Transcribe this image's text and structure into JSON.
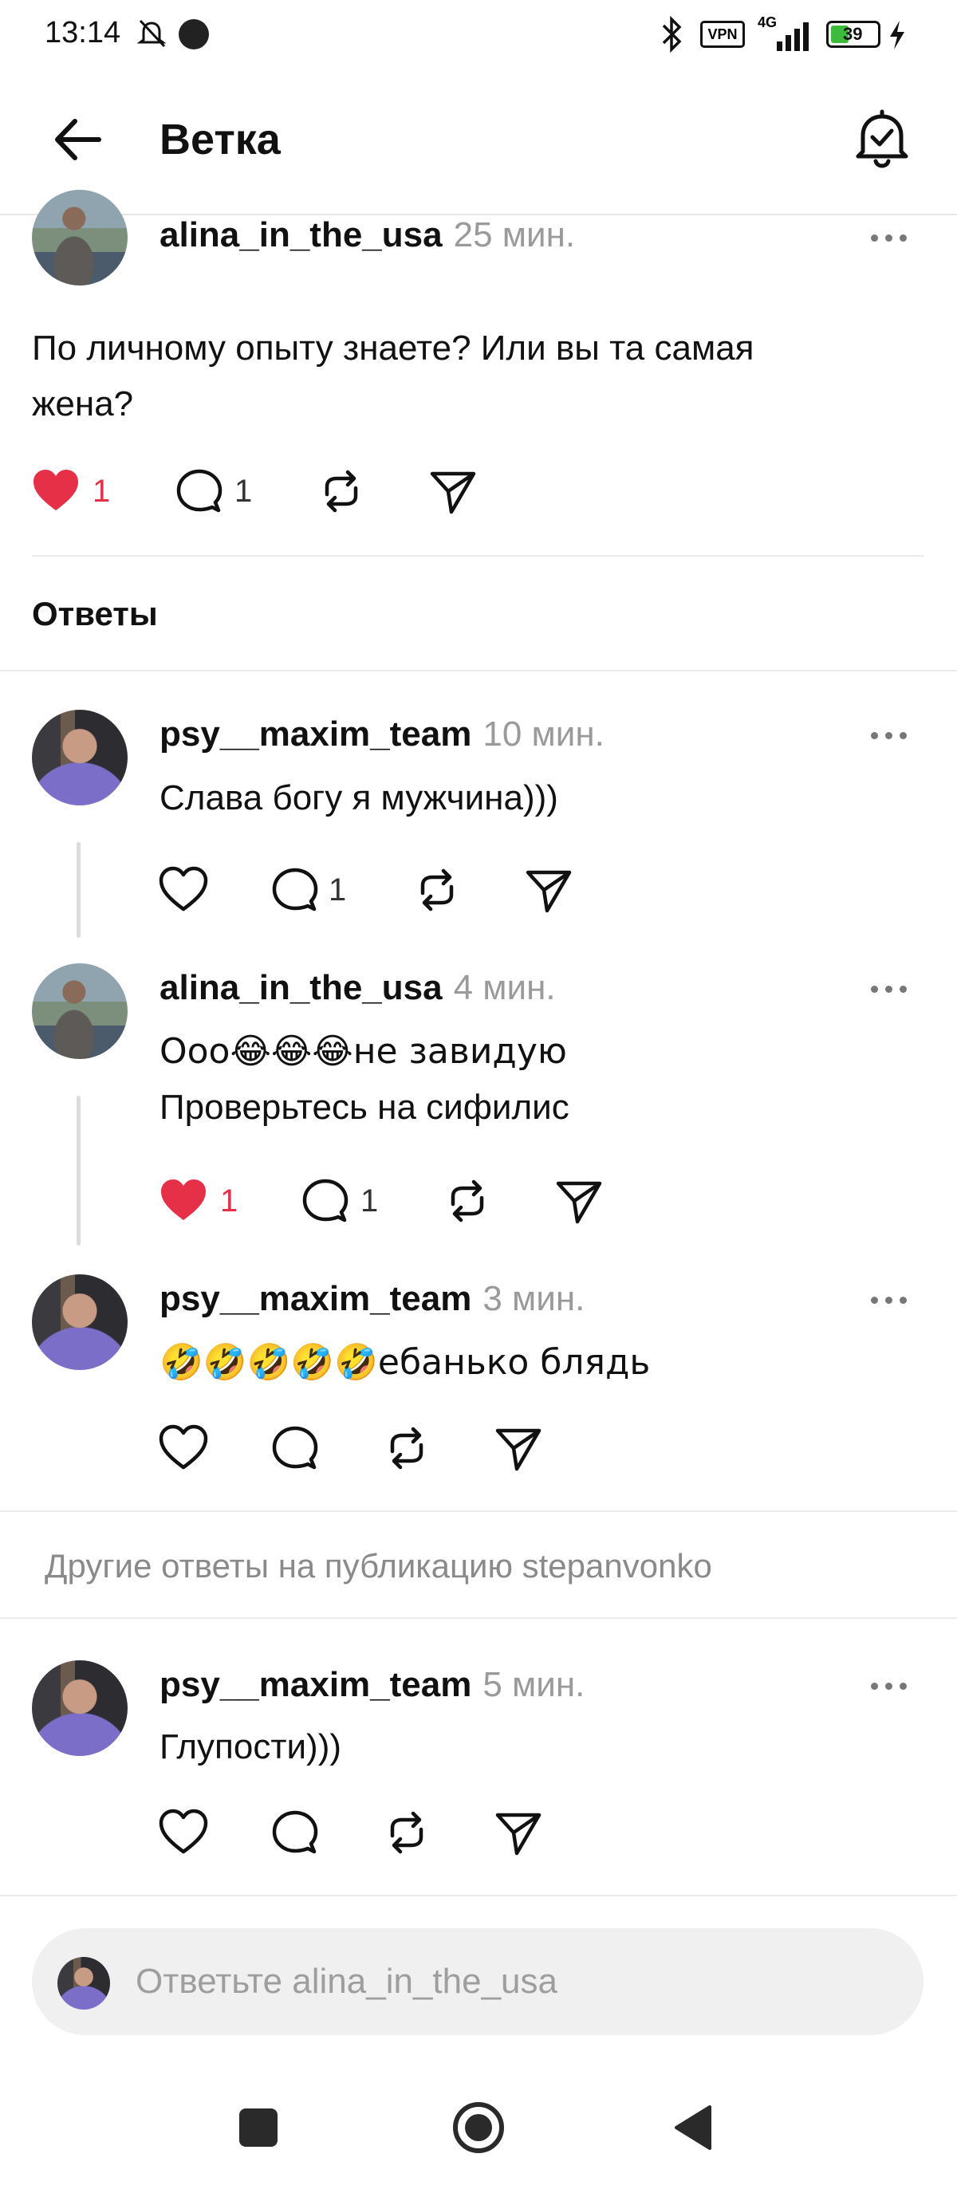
{
  "status_bar": {
    "time": "13:14",
    "battery": "39",
    "network": "4G",
    "vpn": "VPN"
  },
  "header": {
    "title": "Ветка"
  },
  "main_post": {
    "username": "alina_in_the_usa",
    "time": "25 мин.",
    "text_line1": "По личному опыту знаете? Или вы та самая",
    "text_line2": "жена?",
    "likes": "1",
    "comments": "1",
    "liked": true
  },
  "replies_label": "Ответы",
  "replies": [
    {
      "username": "psy__maxim_team",
      "time": "10 мин.",
      "line1": "Слава богу я мужчина)))",
      "line2": "",
      "likes": "",
      "comments": "1"
    },
    {
      "username": "alina_in_the_usa",
      "time": "4 мин.",
      "line1": "Ооо😂😂😂не завидую",
      "line2": "Проверьтесь на сифилис",
      "likes": "1",
      "comments": "1"
    },
    {
      "username": "psy__maxim_team",
      "time": "3 мин.",
      "line1": "🤣🤣🤣🤣🤣ебанько блядь",
      "line2": "",
      "likes": "",
      "comments": ""
    }
  ],
  "other_replies_label": "Другие ответы на публикацию stepanvonko",
  "other_reply": {
    "username": "psy__maxim_team",
    "time": "5 мин.",
    "text": "Глупости)))"
  },
  "reply_input": {
    "placeholder": "Ответьте alina_in_the_usa"
  },
  "colors": {
    "like_red": "#e53048",
    "muted": "#9a9a9a"
  },
  "icons": [
    "back-arrow-icon",
    "bell-check-icon",
    "heart-icon",
    "comment-icon",
    "repost-icon",
    "share-icon",
    "more-icon",
    "nav-square-icon",
    "nav-home-icon",
    "nav-back-icon"
  ]
}
